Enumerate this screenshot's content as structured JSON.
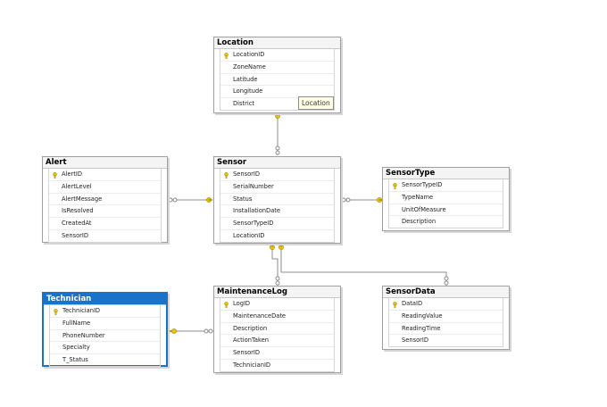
{
  "tables": {
    "location": {
      "title": "Location",
      "columns": [
        "LocationID",
        "ZoneName",
        "Latitude",
        "Longitude",
        "District"
      ],
      "primary_key": "LocationID"
    },
    "alert": {
      "title": "Alert",
      "columns": [
        "AlertID",
        "AlertLevel",
        "AlertMessage",
        "IsResolved",
        "CreatedAt",
        "SensorID"
      ],
      "primary_key": "AlertID"
    },
    "sensor": {
      "title": "Sensor",
      "columns": [
        "SensorID",
        "SerialNumber",
        "Status",
        "InstallationDate",
        "SensorTypeID",
        "LocationID"
      ],
      "primary_key": "SensorID"
    },
    "sensortype": {
      "title": "SensorType",
      "columns": [
        "SensorTypeID",
        "TypeName",
        "UnitOfMeasure",
        "Description"
      ],
      "primary_key": "SensorTypeID"
    },
    "technician": {
      "title": "Technician",
      "columns": [
        "TechnicianID",
        "FullName",
        "PhoneNumber",
        "Specialty",
        "T_Status"
      ],
      "primary_key": "TechnicianID",
      "selected": true
    },
    "maintenancelog": {
      "title": "MaintenanceLog",
      "columns": [
        "LogID",
        "MaintenanceDate",
        "Description",
        "ActionTaken",
        "SensorID",
        "TechnicianID"
      ],
      "primary_key": "LogID"
    },
    "sensordata": {
      "title": "SensorData",
      "columns": [
        "DataID",
        "ReadingValue",
        "ReadingTime",
        "SensorID"
      ],
      "primary_key": "DataID"
    }
  },
  "tooltip": {
    "text": "Location"
  },
  "relationships": [
    {
      "from": "sensor",
      "to": "location"
    },
    {
      "from": "alert",
      "to": "sensor"
    },
    {
      "from": "sensor",
      "to": "sensortype"
    },
    {
      "from": "maintenancelog",
      "to": "sensor"
    },
    {
      "from": "sensordata",
      "to": "sensor"
    },
    {
      "from": "maintenancelog",
      "to": "technician"
    }
  ],
  "colors": {
    "connector": "#8c8c8c",
    "key": "#e8c400",
    "selected": "#1a73c8"
  }
}
